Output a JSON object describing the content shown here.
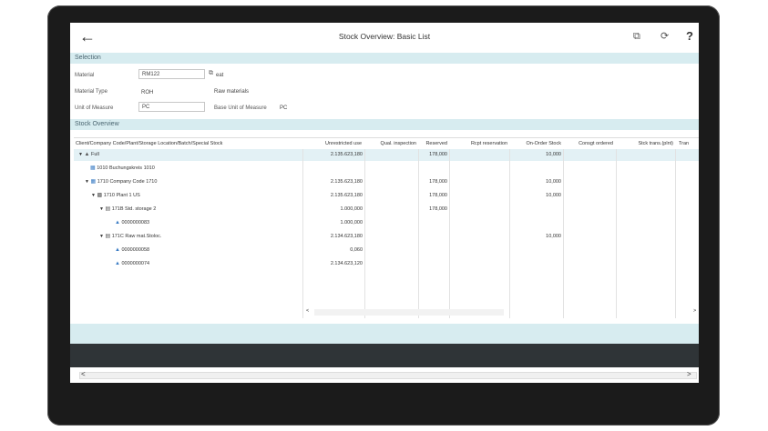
{
  "window": {
    "title": "Stock Overview: Basic List",
    "back_icon": "arrow-left-icon"
  },
  "toolbar": {
    "icons": [
      "open-window-icon",
      "refresh-icon",
      "help-icon"
    ],
    "help_glyph": "?"
  },
  "selection": {
    "section_title": "Selection",
    "material_label": "Material",
    "material_value": "RM122",
    "material_suffix": "eat",
    "material_type_label": "Material Type",
    "material_type_value": "ROH",
    "material_type_desc": "Raw materials",
    "uom_label": "Unit of Measure",
    "uom_value": "PC",
    "base_uom_label": "Base Unit of Measure",
    "base_uom_value": "PC"
  },
  "stock": {
    "section_title": "Stock Overview",
    "columns": [
      "Client/Company Code/Plant/Storage Location/Batch/Special Stock",
      "Unrestricted use",
      "Qual. inspection",
      "Reserved",
      "Rcpt reservation",
      "On-Order Stock",
      "Consgt ordered",
      "Stck trans.(plnt)",
      "Tran"
    ],
    "rows": [
      {
        "label": "Full",
        "unrestricted": "2.135.623,180",
        "qual": "",
        "reserved": "178,000",
        "rcpt": "",
        "onorder": "10,000"
      },
      {
        "label": "1010 Buchungskreis 1010",
        "unrestricted": "",
        "qual": "",
        "reserved": "",
        "rcpt": "",
        "onorder": ""
      },
      {
        "label": "1710 Company Code 1710",
        "unrestricted": "2.135.623,180",
        "qual": "",
        "reserved": "178,000",
        "rcpt": "",
        "onorder": "10,000"
      },
      {
        "label": "1710 Plant 1 US",
        "unrestricted": "2.135.623,180",
        "qual": "",
        "reserved": "178,000",
        "rcpt": "",
        "onorder": "10,000"
      },
      {
        "label": "171B Std. storage 2",
        "unrestricted": "1.000,000",
        "qual": "",
        "reserved": "178,000",
        "rcpt": "",
        "onorder": ""
      },
      {
        "label": "0000000083",
        "unrestricted": "1.000,000",
        "qual": "",
        "reserved": "",
        "rcpt": "",
        "onorder": ""
      },
      {
        "label": "171C Raw mat.Stoloc.",
        "unrestricted": "2.134.623,180",
        "qual": "",
        "reserved": "",
        "rcpt": "",
        "onorder": "10,000"
      },
      {
        "label": "0000000058",
        "unrestricted": "0,060",
        "qual": "",
        "reserved": "",
        "rcpt": "",
        "onorder": ""
      },
      {
        "label": "0000000074",
        "unrestricted": "2.134.623,120",
        "qual": "",
        "reserved": "",
        "rcpt": "",
        "onorder": ""
      }
    ]
  },
  "scroll": {
    "left_arrow": "<",
    "right_arrow": ">"
  },
  "colors": {
    "section_bg": "#d7ecf0",
    "highlight_row": "#e3f1f5",
    "dark_bar": "#2f3437"
  }
}
